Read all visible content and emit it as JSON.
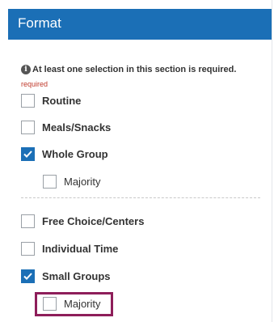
{
  "header": {
    "title": "Format"
  },
  "notice": {
    "text": "At least one selection in this section is required."
  },
  "required_label": "required",
  "options": [
    {
      "label": "Routine",
      "checked": false
    },
    {
      "label": "Meals/Snacks",
      "checked": false
    },
    {
      "label": "Whole Group",
      "checked": true
    },
    {
      "label": "Majority",
      "checked": false
    },
    {
      "label": "Free Choice/Centers",
      "checked": false
    },
    {
      "label": "Individual Time",
      "checked": false
    },
    {
      "label": "Small Groups",
      "checked": true
    },
    {
      "label": "Majority",
      "checked": false
    }
  ],
  "colors": {
    "header": "#1b6fb6",
    "checkbox_checked": "#1b6fb6",
    "required": "#c0392b",
    "highlight": "#8e1e5a"
  }
}
